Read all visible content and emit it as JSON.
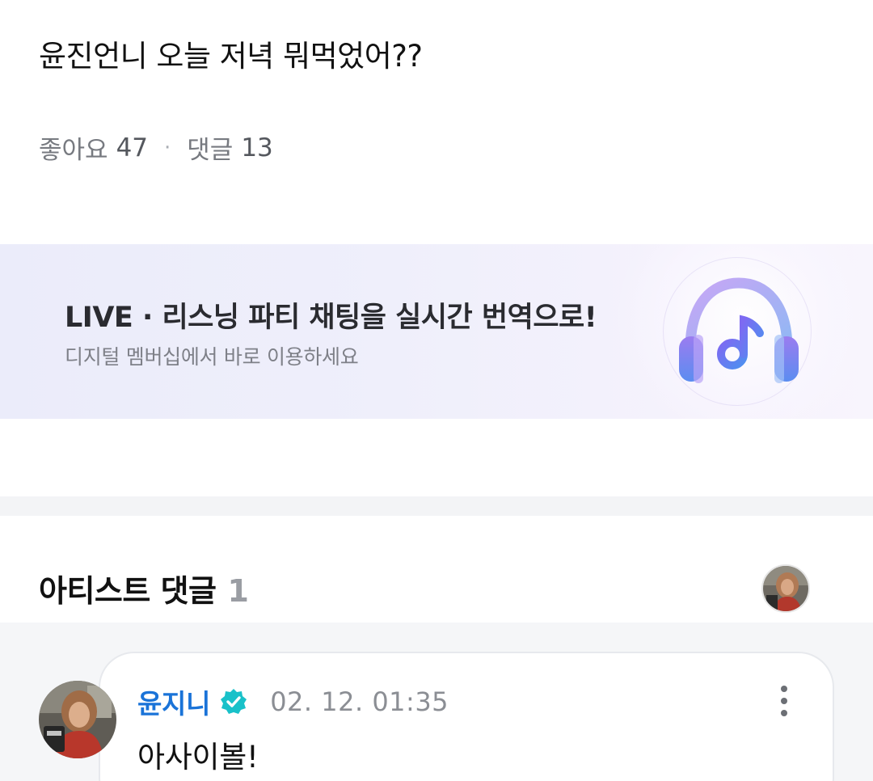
{
  "post": {
    "title": "윤진언니 오늘 저녁 뭐먹었어??",
    "likes_label": "좋아요",
    "likes_count": "47",
    "separator": "·",
    "comments_label": "댓글",
    "comments_count": "13"
  },
  "banner": {
    "title": "LIVE · 리스닝 파티 채팅을 실시간 번역으로!",
    "subtitle": "디지털 멤버십에서 바로 이용하세요",
    "icon": "headphones-music-note-icon"
  },
  "artist_comments": {
    "title": "아티스트 댓글",
    "count": "1",
    "comments": [
      {
        "author": "윤지니",
        "verified_icon": "verified-badge-icon",
        "timestamp": "02. 12. 01:35",
        "text": "아사이볼!"
      }
    ]
  },
  "colors": {
    "author_blue": "#1a73d8",
    "verified_teal": "#19c1c9",
    "banner_bg": "#eeeefb",
    "muted_text": "#777a80"
  }
}
